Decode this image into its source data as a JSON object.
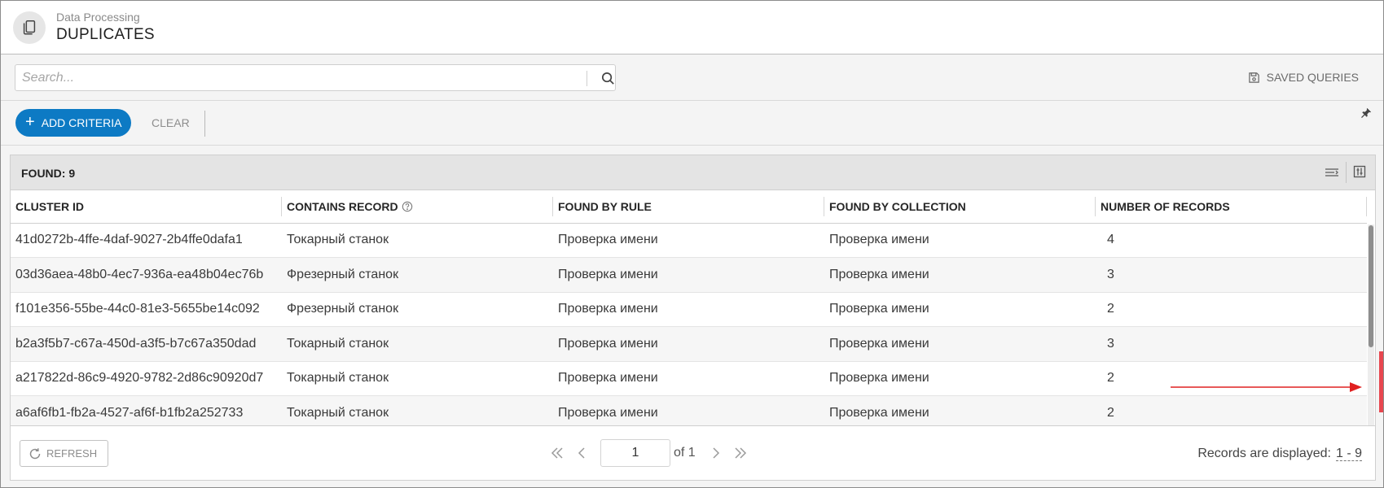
{
  "header": {
    "subtitle": "Data Processing",
    "title": "DUPLICATES",
    "icon": "documents-icon"
  },
  "search": {
    "placeholder": "Search...",
    "value": "",
    "icon": "search-icon"
  },
  "saved_queries": {
    "label": "SAVED QUERIES",
    "icon": "save-icon"
  },
  "criteria": {
    "add_label": "ADD CRITERIA",
    "clear_label": "CLEAR",
    "pin_icon": "pin-icon"
  },
  "results": {
    "found_label": "FOUND: 9",
    "columns": [
      "CLUSTER ID",
      "CONTAINS RECORD",
      "FOUND BY RULE",
      "FOUND BY COLLECTION",
      "NUMBER OF RECORDS"
    ],
    "rows": [
      [
        "41d0272b-4ffe-4daf-9027-2b4ffe0dafa1",
        "Токарный станок",
        "Проверка имени",
        "Проверка имени",
        "4"
      ],
      [
        "03d36aea-48b0-4ec7-936a-ea48b04ec76b",
        "Фрезерный станок",
        "Проверка имени",
        "Проверка имени",
        "3"
      ],
      [
        "f101e356-55be-44c0-81e3-5655be14c092",
        "Фрезерный станок",
        "Проверка имени",
        "Проверка имени",
        "2"
      ],
      [
        "b2a3f5b7-c67a-450d-a3f5-b7c67a350dad",
        "Токарный станок",
        "Проверка имени",
        "Проверка имени",
        "3"
      ],
      [
        "a217822d-86c9-4920-9782-2d86c90920d7",
        "Токарный станок",
        "Проверка имени",
        "Проверка имени",
        "2"
      ],
      [
        "a6af6fb1-fb2a-4527-af6f-b1fb2a252733",
        "Токарный станок",
        "Проверка имени",
        "Проверка имени",
        "2"
      ]
    ]
  },
  "footer": {
    "refresh_label": "REFRESH",
    "page": "1",
    "of_label": "of 1",
    "records_label": "Records are displayed:",
    "records_range": "1 - 9"
  },
  "colors": {
    "accent": "#0d7ac4",
    "annotation": "#e8464f"
  }
}
